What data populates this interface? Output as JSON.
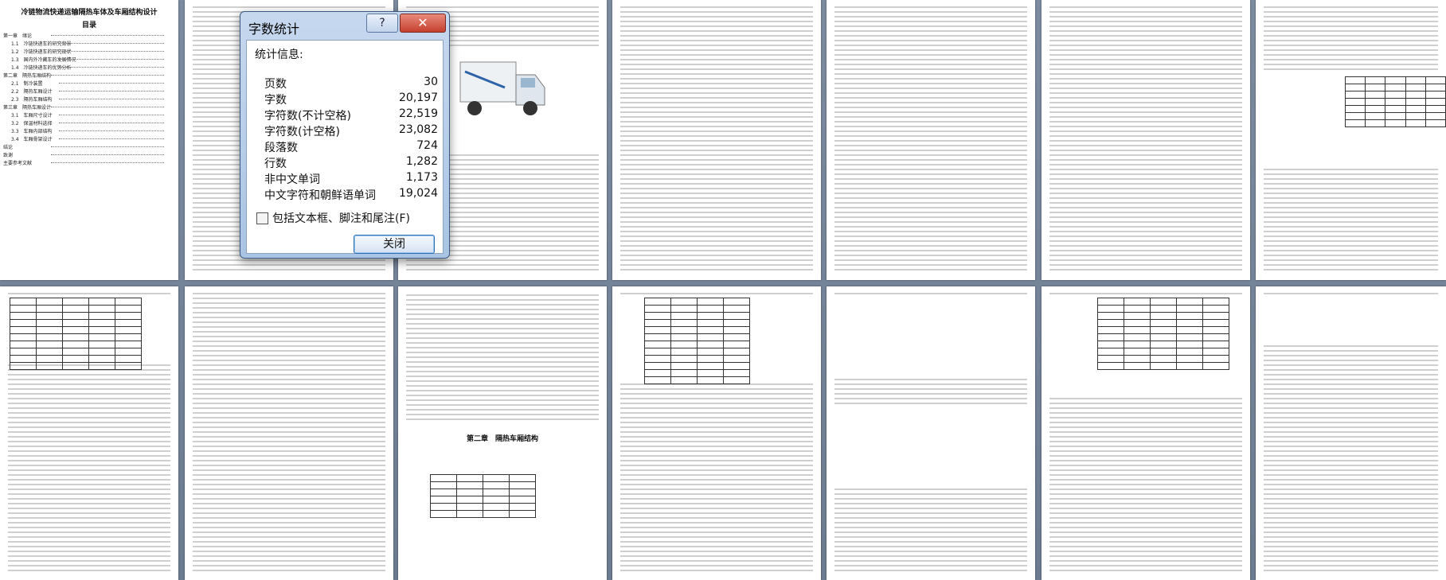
{
  "document": {
    "title": "冷链物流快递运输隔热车体及车厢结构设计",
    "toc_heading": "目录",
    "toc_items": [
      "第一章　绪论",
      "1.1　冷链快递车的研究背景",
      "1.2　冷链快递车的研究现状",
      "1.3　国内外冷藏车的发展情况",
      "1.4　冷链快递车的优势分析",
      "第二章　隔热车厢结构",
      "2.1　制冷装置",
      "2.2　隔热车厢设计",
      "2.3　隔热车厢结构",
      "第三章　隔热车厢设计",
      "3.1　车厢尺寸设计",
      "3.2　保温材料选择",
      "3.3　车厢内部结构",
      "3.4　车厢骨架设计",
      "结论",
      "致谢",
      "主要参考文献"
    ],
    "chapter_two_title": "第二章　隔热车厢结构"
  },
  "dialog": {
    "title": "字数统计",
    "help_label": "?",
    "close_icon": "✕",
    "stats_heading": "统计信息:",
    "stats": [
      {
        "label": "页数",
        "value": "30"
      },
      {
        "label": "字数",
        "value": "20,197"
      },
      {
        "label": "字符数(不计空格)",
        "value": "22,519"
      },
      {
        "label": "字符数(计空格)",
        "value": "23,082"
      },
      {
        "label": "段落数",
        "value": "724"
      },
      {
        "label": "行数",
        "value": "1,282"
      },
      {
        "label": "非中文单词",
        "value": "1,173"
      },
      {
        "label": "中文字符和朝鲜语单词",
        "value": "19,024"
      }
    ],
    "checkbox_label": "包括文本框、脚注和尾注(F)",
    "close_button": "关闭"
  },
  "colors": {
    "workspace": "#6f7f92",
    "dialog_frame": "#a9c4e4",
    "close_red": "#c6402e"
  }
}
